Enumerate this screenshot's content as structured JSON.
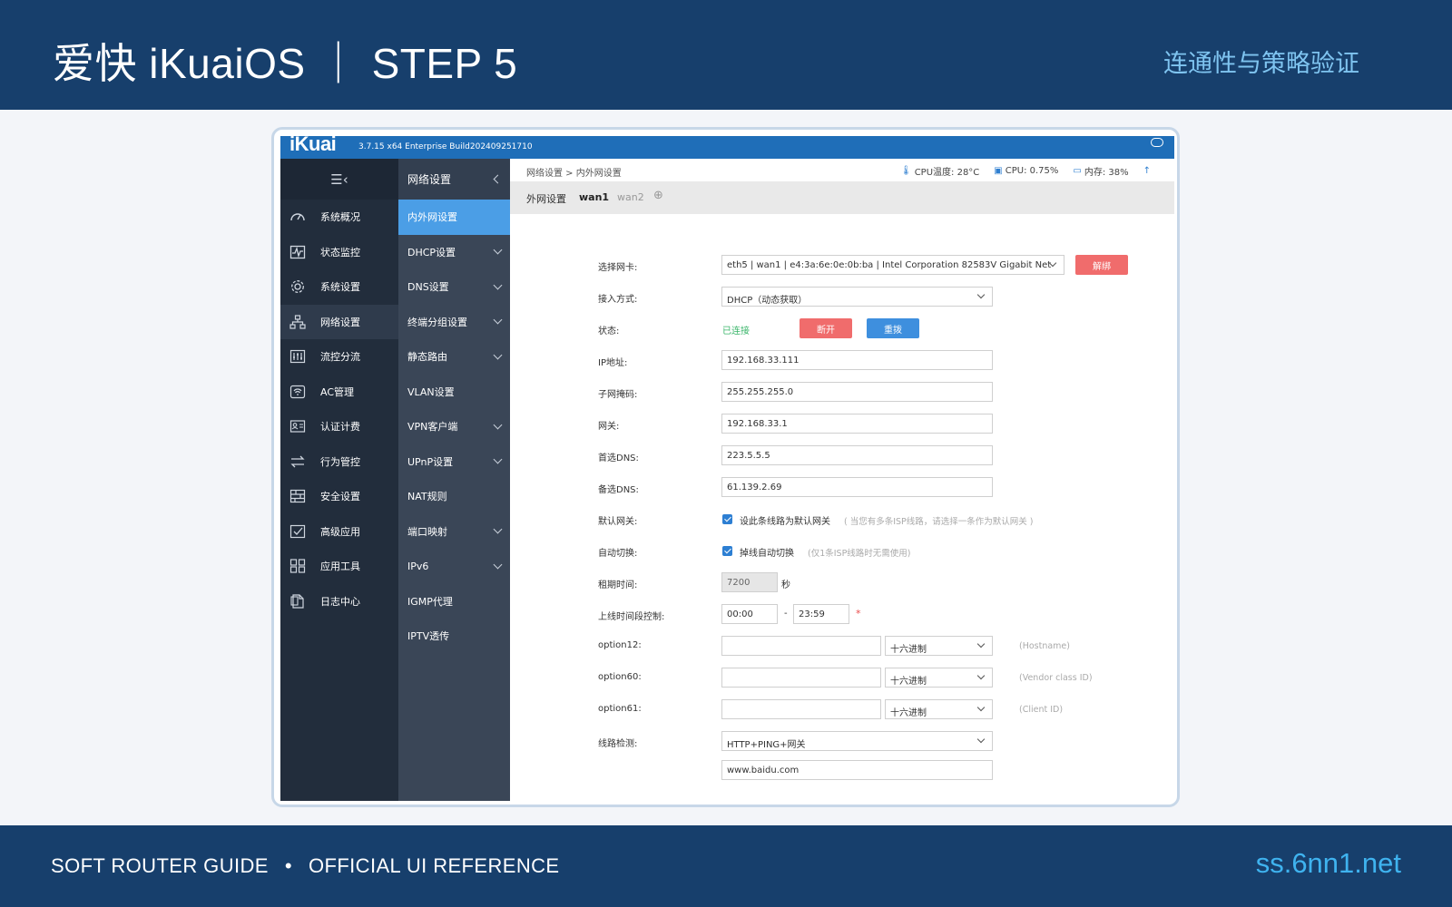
{
  "banner": {
    "title": "爱快 iKuaiOS ｜ STEP 5",
    "subtitle": "连通性与策略验证"
  },
  "footer": {
    "left_a": "SOFT ROUTER GUIDE",
    "dot": "•",
    "left_b": "OFFICIAL UI REFERENCE",
    "site": "ss.6nn1.net"
  },
  "app": {
    "logo": "iKuai",
    "version": "3.7.15 x64 Enterprise Build202409251710",
    "hamburger": "☰‹"
  },
  "sidebar": {
    "items": [
      {
        "label": "系统概况",
        "icon": "dashboard-icon"
      },
      {
        "label": "状态监控",
        "icon": "monitor-icon"
      },
      {
        "label": "系统设置",
        "icon": "gear-icon"
      },
      {
        "label": "网络设置",
        "icon": "network-icon"
      },
      {
        "label": "流控分流",
        "icon": "sliders-icon"
      },
      {
        "label": "AC管理",
        "icon": "wifi-icon"
      },
      {
        "label": "认证计费",
        "icon": "id-card-icon"
      },
      {
        "label": "行为管控",
        "icon": "swap-icon"
      },
      {
        "label": "安全设置",
        "icon": "firewall-icon"
      },
      {
        "label": "高级应用",
        "icon": "check-box-icon"
      },
      {
        "label": "应用工具",
        "icon": "apps-icon"
      },
      {
        "label": "日志中心",
        "icon": "file-icon"
      }
    ]
  },
  "subnav": {
    "title": "网络设置",
    "items": [
      {
        "label": "内外网设置",
        "has_arrow": false
      },
      {
        "label": "DHCP设置",
        "has_arrow": true
      },
      {
        "label": "DNS设置",
        "has_arrow": true
      },
      {
        "label": "终端分组设置",
        "has_arrow": true
      },
      {
        "label": "静态路由",
        "has_arrow": true
      },
      {
        "label": "VLAN设置",
        "has_arrow": false
      },
      {
        "label": "VPN客户端",
        "has_arrow": true
      },
      {
        "label": "UPnP设置",
        "has_arrow": true
      },
      {
        "label": "NAT规则",
        "has_arrow": false
      },
      {
        "label": "端口映射",
        "has_arrow": true
      },
      {
        "label": "IPv6",
        "has_arrow": true
      },
      {
        "label": "IGMP代理",
        "has_arrow": false
      },
      {
        "label": "IPTV透传",
        "has_arrow": false
      }
    ]
  },
  "main": {
    "breadcrumb": "网络设置 > 内外网设置",
    "stats": {
      "cpu_temp": "CPU温度: 28°C",
      "cpu": "CPU: 0.75%",
      "mem": "内存: 38%"
    },
    "tabs": {
      "label": "外网设置",
      "active": "wan1",
      "other": "wan2",
      "add": "⊕"
    },
    "form": {
      "nic_label": "选择网卡:",
      "nic_value": "eth5 | wan1 | e4:3a:6e:0e:0b:ba | Intel Corporation 82583V Gigabit Net",
      "unbind": "解绑",
      "access_label": "接入方式:",
      "access_value": "DHCP（动态获取）",
      "status_label": "状态:",
      "status_value": "已连接",
      "disconnect": "断开",
      "redial": "重拨",
      "ip_label": "IP地址:",
      "ip_value": "192.168.33.111",
      "mask_label": "子网掩码:",
      "mask_value": "255.255.255.0",
      "gw_label": "网关:",
      "gw_value": "192.168.33.1",
      "dns1_label": "首选DNS:",
      "dns1_value": "223.5.5.5",
      "dns2_label": "备选DNS:",
      "dns2_value": "61.139.2.69",
      "defgw_label": "默认网关:",
      "defgw_check": "设此条线路为默认网关",
      "defgw_note": "( 当您有多条ISP线路，请选择一条作为默认网关 )",
      "auto_label": "自动切换:",
      "auto_check": "掉线自动切换",
      "auto_note": "(仅1条ISP线路时无需使用)",
      "lease_label": "租期时间:",
      "lease_value": "7200",
      "lease_unit": "秒",
      "online_label": "上线时间段控制:",
      "online_start": "00:00",
      "online_sep": "-",
      "online_end": "23:59",
      "online_star": "*",
      "opt12_label": "option12:",
      "opt12_value": "",
      "opt12_enc": "十六进制",
      "opt12_note": "(Hostname)",
      "opt60_label": "option60:",
      "opt60_value": "",
      "opt60_enc": "十六进制",
      "opt60_note": "(Vendor class ID)",
      "opt61_label": "option61:",
      "opt61_value": "",
      "opt61_enc": "十六进制",
      "opt61_note": "(Client ID)",
      "detect_label": "线路检测:",
      "detect_value": "HTTP+PING+网关",
      "detect_host": "www.baidu.com"
    }
  }
}
